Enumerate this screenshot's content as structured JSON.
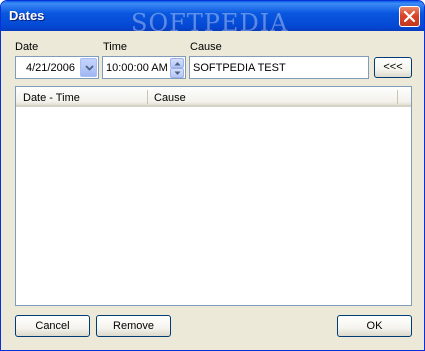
{
  "window": {
    "title": "Dates"
  },
  "watermark": {
    "brand": "SOFTPEDIA"
  },
  "date": {
    "label": "Date",
    "value": "4/21/2006"
  },
  "time": {
    "label": "Time",
    "value": "10:00:00 AM"
  },
  "cause": {
    "label": "Cause",
    "value": "SOFTPEDIA TEST"
  },
  "actions": {
    "add_label": "<<<"
  },
  "list": {
    "columns": [
      "Date - Time",
      "Cause"
    ],
    "rows": []
  },
  "footer": {
    "cancel_label": "Cancel",
    "remove_label": "Remove",
    "ok_label": "OK"
  },
  "colors": {
    "titlebar": "#0a58e0",
    "window_bg": "#ece9d8",
    "field_border": "#7f9db9"
  },
  "icons": [
    "close-icon",
    "chevron-down-icon",
    "spin-up-icon",
    "spin-down-icon"
  ]
}
